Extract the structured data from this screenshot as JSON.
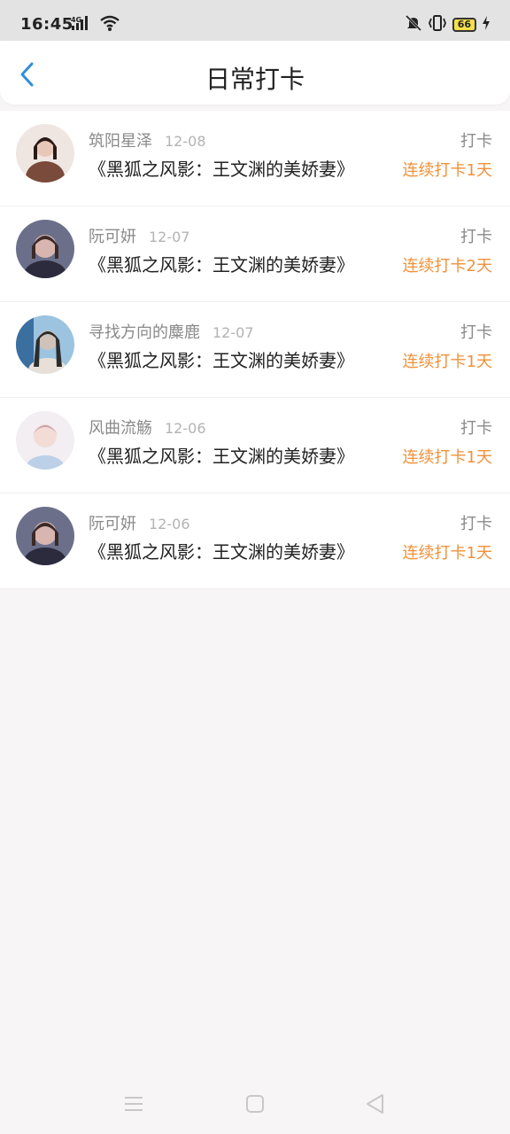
{
  "status_bar": {
    "time": "16:45",
    "network": "4G",
    "battery": "66",
    "icons": [
      "signal-icon",
      "wifi-icon",
      "mute-bell-icon",
      "vibrate-icon",
      "battery-icon",
      "charging-icon"
    ]
  },
  "header": {
    "title": "日常打卡",
    "back_icon": "chevron-left-icon"
  },
  "records": [
    {
      "user": "筑阳星泽",
      "date": "12-08",
      "action": "打卡",
      "book": "《黑狐之风影：王文渊的美娇妻》",
      "streak": "连续打卡1天",
      "avatar_colors": [
        "#7a4a3a",
        "#e9c7b8"
      ]
    },
    {
      "user": "阮可妍",
      "date": "12-07",
      "action": "打卡",
      "book": "《黑狐之风影：王文渊的美娇妻》",
      "streak": "连续打卡2天",
      "avatar_colors": [
        "#2b2b3d",
        "#d9b5b0"
      ]
    },
    {
      "user": "寻找方向的麋鹿",
      "date": "12-07",
      "action": "打卡",
      "book": "《黑狐之风影：王文渊的美娇妻》",
      "streak": "连续打卡1天",
      "avatar_colors": [
        "#3a6fa0",
        "#cfc2b8"
      ]
    },
    {
      "user": "风曲流觞",
      "date": "12-06",
      "action": "打卡",
      "book": "《黑狐之风影：王文渊的美娇妻》",
      "streak": "连续打卡1天",
      "avatar_colors": [
        "#c8a0a8",
        "#e8d8e0"
      ]
    },
    {
      "user": "阮可妍",
      "date": "12-06",
      "action": "打卡",
      "book": "《黑狐之风影：王文渊的美娇妻》",
      "streak": "连续打卡1天",
      "avatar_colors": [
        "#2b2b3d",
        "#d9b5b0"
      ]
    }
  ],
  "colors": {
    "accent_orange": "#f0913a",
    "back_blue": "#2f8fd8",
    "page_bg": "#f7f5f6"
  },
  "nav_bar": {
    "icons": [
      "menu-icon",
      "home-square-icon",
      "back-triangle-icon"
    ]
  }
}
